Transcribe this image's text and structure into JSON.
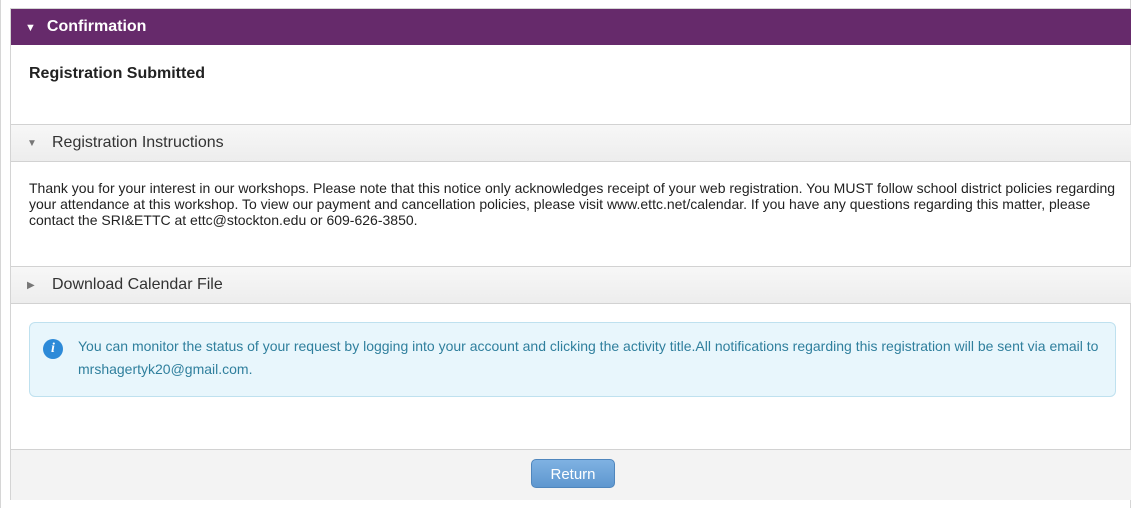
{
  "header": {
    "title": "Confirmation",
    "caret_icon": "caret-down-icon",
    "color": "#662a6b"
  },
  "status": {
    "title": "Registration Submitted"
  },
  "instructions_section": {
    "title": "Registration Instructions",
    "expanded": true,
    "text": "Thank you for your interest in our workshops. Please note that this notice only acknowledges receipt of your web registration. You MUST follow school district policies regarding your attendance at this workshop. To view our payment and cancellation policies, please visit www.ettc.net/calendar. If you have any questions regarding this matter, please contact the SRI&ETTC at ettc@stockton.edu or 609-626-3850."
  },
  "calendar_section": {
    "title": "Download Calendar File",
    "expanded": false
  },
  "info_box": {
    "icon": "info-icon",
    "text": "You can monitor the status of your request by logging into your account and clicking the activity title.All notifications regarding this registration will be sent via email to mrshagertyk20@gmail.com."
  },
  "footer": {
    "return_label": "Return"
  }
}
